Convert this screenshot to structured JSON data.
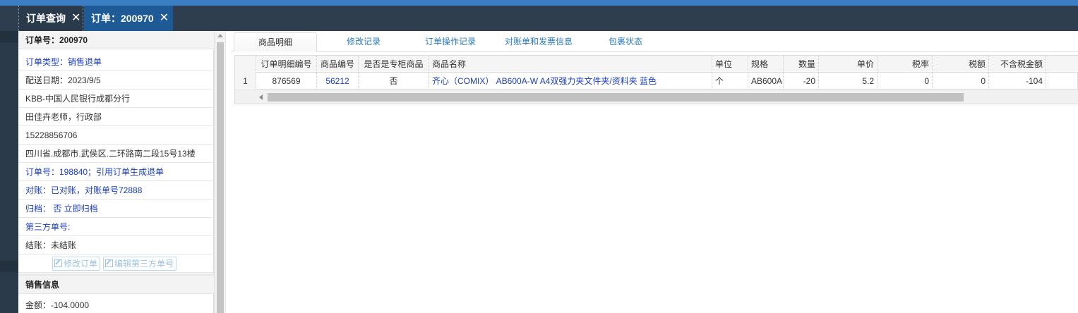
{
  "tabs": [
    {
      "label": "订单查询",
      "close": "✕"
    },
    {
      "label": "订单：200970",
      "close": "✕"
    }
  ],
  "order": {
    "order_no": "订单号：200970",
    "order_type": "订单类型：销售退单",
    "delivery_date": "配送日期：2023/9/5",
    "customer": "KBB-中国人民银行成都分行",
    "contact": "田佳卉老师，行政部",
    "phone": "15228856706",
    "address": "四川省.成都市.武侯区.二环路南二段15号13楼",
    "ref_order": "订单号：198840；引用订单生成退单",
    "reconcile": "对账：已对账，对账单号72888",
    "archive": "归档：   否 立即归档",
    "third_party_no": "第三方单号:",
    "settlement": "结账：未结账",
    "btn_edit_order": "修改订单",
    "btn_edit_third_party": "编辑第三方单号"
  },
  "sales": {
    "section_title": "销售信息",
    "amount": "金额：-104.0000"
  },
  "detail_tabs": [
    "商品明细",
    "修改记录",
    "订单操作记录",
    "对账单和发票信息",
    "包裹状态"
  ],
  "table": {
    "headers": [
      "",
      "订单明细编号",
      "商品编号",
      "是否是专柜商品",
      "商品名称",
      "单位",
      "规格",
      "数量",
      "单价",
      "税率",
      "税额",
      "不含税金额"
    ],
    "rows": [
      [
        "1",
        "876569",
        "56212",
        "否",
        "齐心（COMIX） AB600A-W A4双强力夹文件夹/资料夹 蓝色",
        "个",
        "AB600A",
        "-20",
        "5.2",
        "0",
        "0",
        "-104"
      ]
    ]
  }
}
